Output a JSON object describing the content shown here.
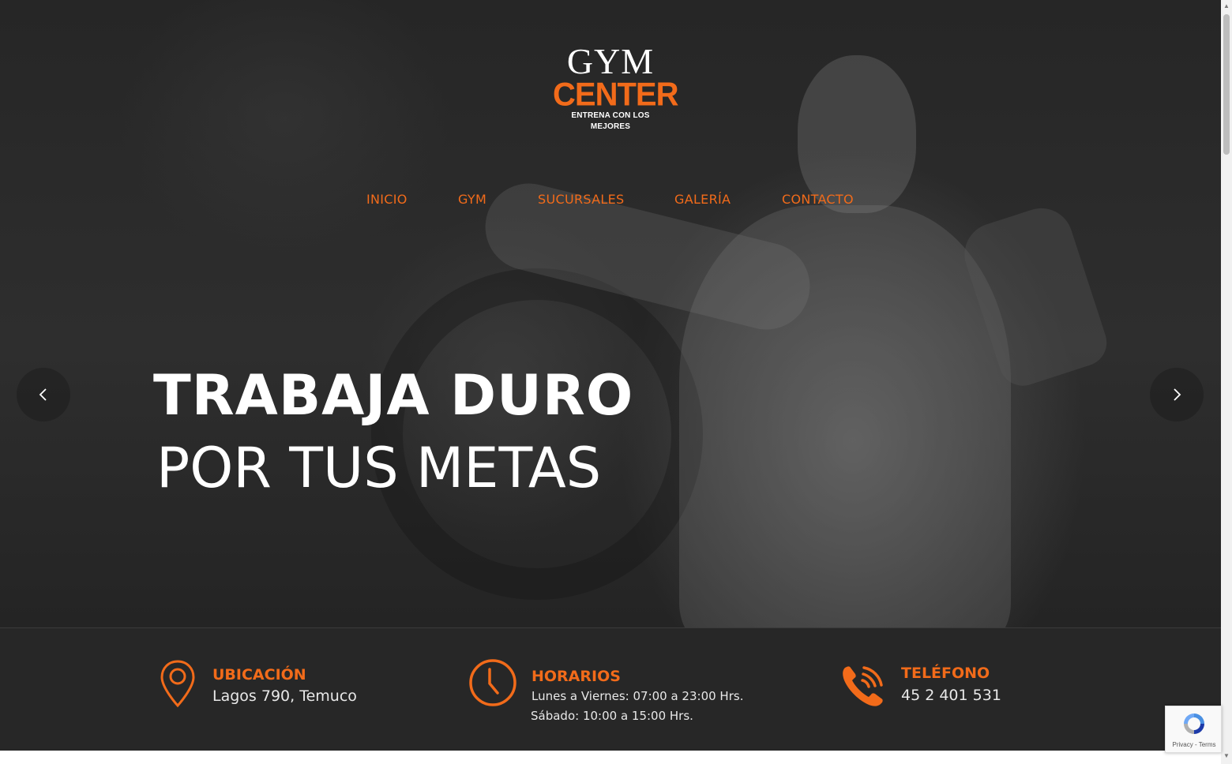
{
  "logo": {
    "line1": "GYM",
    "line2": "CENTER",
    "tagline": "ENTRENA CON LOS MEJORES"
  },
  "nav": {
    "items": [
      {
        "label": "INICIO"
      },
      {
        "label": "GYM"
      },
      {
        "label": "SUCURSALES"
      },
      {
        "label": "GALERÍA"
      },
      {
        "label": "CONTACTO"
      }
    ]
  },
  "hero": {
    "headline_line1": "TRABAJA DURO",
    "headline_line2": "POR TUS METAS",
    "prev_icon": "chevron-left-icon",
    "next_icon": "chevron-right-icon"
  },
  "info": {
    "location": {
      "title": "UBICACIÓN",
      "value": "Lagos 790, Temuco",
      "icon": "map-pin-icon"
    },
    "hours": {
      "title": "HORARIOS",
      "weekdays": "Lunes a Viernes: 07:00 a 23:00 Hrs.",
      "saturday": "Sábado: 10:00 a 15:00 Hrs.",
      "icon": "clock-icon"
    },
    "phone": {
      "title": "TELÉFONO",
      "value": "45 2 401 531",
      "icon": "phone-ringing-icon"
    }
  },
  "recaptcha": {
    "text": "Privacy - Terms"
  },
  "colors": {
    "accent": "#f26b1a",
    "bar": "#282828",
    "text": "#ffffff"
  }
}
